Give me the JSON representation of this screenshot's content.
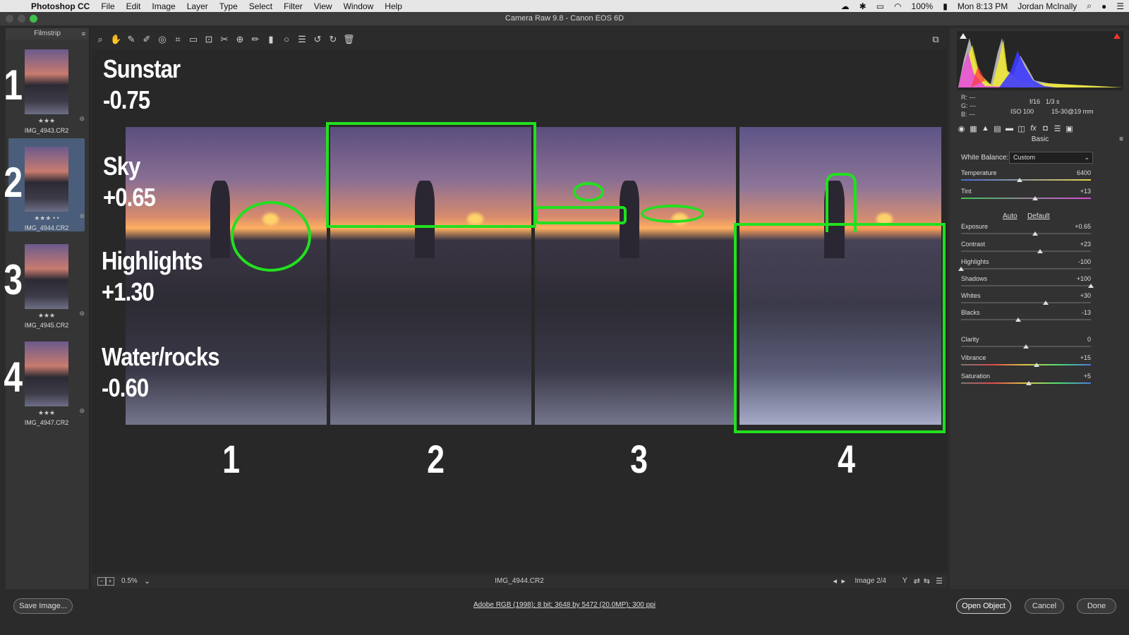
{
  "menubar": {
    "app": "Photoshop CC",
    "items": [
      "File",
      "Edit",
      "Image",
      "Layer",
      "Type",
      "Select",
      "Filter",
      "View",
      "Window",
      "Help"
    ],
    "battery": "100%",
    "clock": "Mon 8:13 PM",
    "user": "Jordan McInally"
  },
  "window": {
    "title": "Camera Raw 9.8  -  Canon EOS 6D"
  },
  "filmstrip": {
    "title": "Filmstrip",
    "items": [
      {
        "number": "1",
        "stars": "★★★",
        "filename": "IMG_4943.CR2"
      },
      {
        "number": "2",
        "stars": "★★★ • •",
        "filename": "IMG_4944.CR2"
      },
      {
        "number": "3",
        "stars": "★★★",
        "filename": "IMG_4945.CR2"
      },
      {
        "number": "4",
        "stars": "★★★",
        "filename": "IMG_4947.CR2"
      }
    ]
  },
  "overlay": {
    "sunstar": {
      "label": "Sunstar",
      "value": "-0.75"
    },
    "sky": {
      "label": "Sky",
      "value": "+0.65"
    },
    "highlights": {
      "label": "Highlights",
      "value": "+1.30"
    },
    "water": {
      "label": "Water/rocks",
      "value": "-0.60"
    },
    "numbers": [
      "1",
      "2",
      "3",
      "4"
    ]
  },
  "status": {
    "zoom": "0.5%",
    "filename": "IMG_4944.CR2",
    "image_nav": "Image 2/4"
  },
  "bottom": {
    "save_label": "Save Image...",
    "info": "Adobe RGB (1998); 8 bit; 3648 by 5472 (20.0MP); 300 ppi",
    "open_label": "Open Object",
    "cancel_label": "Cancel",
    "done_label": "Done"
  },
  "histogram": {
    "r": "R:  ---",
    "g": "G:  ---",
    "b": "B:  ---",
    "aperture": "f/16",
    "shutter": "1/3 s",
    "iso": "ISO 100",
    "lens": "15-30@19 mm"
  },
  "panel": {
    "title": "Basic",
    "wb_label": "White Balance:",
    "wb_value": "Custom",
    "auto": "Auto",
    "default": "Default",
    "sliders": [
      {
        "label": "Temperature",
        "value": "6400",
        "pos": 0.45
      },
      {
        "label": "Tint",
        "value": "+13",
        "pos": 0.57
      },
      {
        "label": "Exposure",
        "value": "+0.65",
        "pos": 0.57
      },
      {
        "label": "Contrast",
        "value": "+23",
        "pos": 0.61
      },
      {
        "label": "Highlights",
        "value": "-100",
        "pos": 0.0
      },
      {
        "label": "Shadows",
        "value": "+100",
        "pos": 1.0
      },
      {
        "label": "Whites",
        "value": "+30",
        "pos": 0.65
      },
      {
        "label": "Blacks",
        "value": "-13",
        "pos": 0.44
      },
      {
        "label": "Clarity",
        "value": "0",
        "pos": 0.5
      },
      {
        "label": "Vibrance",
        "value": "+15",
        "pos": 0.58
      },
      {
        "label": "Saturation",
        "value": "+5",
        "pos": 0.52
      }
    ]
  }
}
